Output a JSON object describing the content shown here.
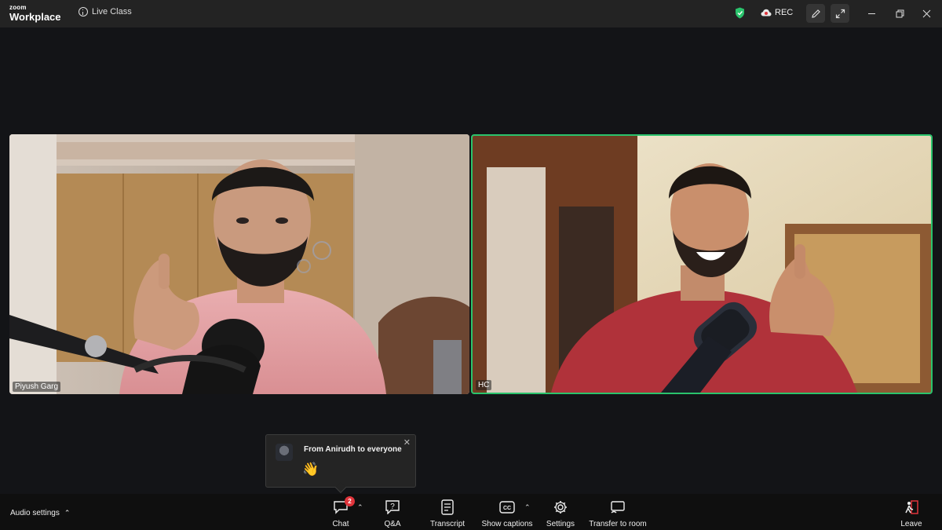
{
  "app": {
    "brand_top": "zoom",
    "brand_bottom": "Workplace"
  },
  "meeting": {
    "title": "Live Class"
  },
  "titlebar": {
    "rec_label": "REC"
  },
  "participants": [
    {
      "name": "Piyush Garg",
      "active_speaker": false
    },
    {
      "name": "HC",
      "active_speaker": true
    }
  ],
  "chat_popup": {
    "from": "From Anirudh to everyone",
    "message": "👋"
  },
  "toolbar": {
    "audio_settings": "Audio settings",
    "chat": "Chat",
    "chat_badge": "2",
    "qa": "Q&A",
    "transcript": "Transcript",
    "captions": "Show captions",
    "settings": "Settings",
    "transfer": "Transfer to room",
    "leave": "Leave"
  },
  "colors": {
    "active_border": "#2ac36c",
    "badge": "#e0343b",
    "shield": "#2ac36c",
    "leave": "#e0343b"
  }
}
